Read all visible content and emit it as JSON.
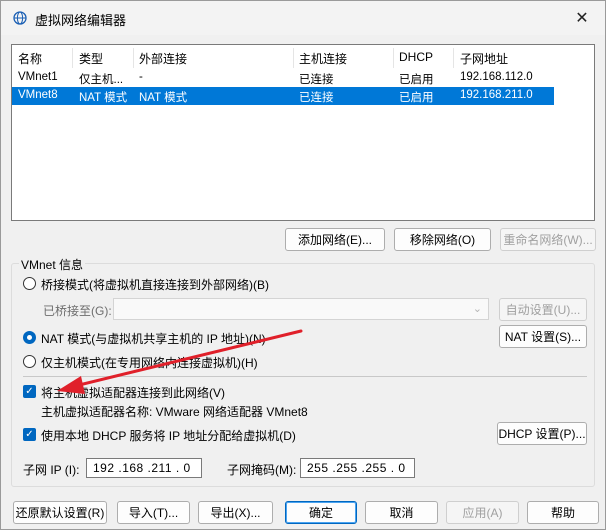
{
  "window": {
    "title": "虚拟网络编辑器",
    "close_label": "✕",
    "icon": "network-globe-icon"
  },
  "table": {
    "headers": [
      "名称",
      "类型",
      "外部连接",
      "主机连接",
      "DHCP",
      "子网地址"
    ],
    "rows": [
      {
        "name": "VMnet1",
        "type": "仅主机...",
        "external": "-",
        "host": "已连接",
        "dhcp": "已启用",
        "subnet": "192.168.112.0",
        "selected": false
      },
      {
        "name": "VMnet8",
        "type": "NAT 模式",
        "external": "NAT 模式",
        "host": "已连接",
        "dhcp": "已启用",
        "subnet": "192.168.211.0",
        "selected": true
      }
    ]
  },
  "network_buttons": {
    "add": "添加网络(E)...",
    "remove": "移除网络(O)",
    "rename": "重命名网络(W)..."
  },
  "vmnet_info": {
    "group_title": "VMnet 信息",
    "bridged_label": "桥接模式(将虚拟机直接连接到外部网络)(B)",
    "bridged_to_label": "已桥接至(G):",
    "bridged_to_value": "",
    "auto_settings": "自动设置(U)...",
    "nat_label": "NAT 模式(与虚拟机共享主机的 IP 地址)(N)",
    "nat_settings": "NAT 设置(S)...",
    "hostonly_label": "仅主机模式(在专用网络内连接虚拟机)(H)",
    "selected_mode": "nat",
    "connect_adapter_label": "将主机虚拟适配器连接到此网络(V)",
    "connect_adapter_checked": true,
    "adapter_name": "主机虚拟适配器名称: VMware 网络适配器 VMnet8",
    "use_dhcp_label": "使用本地 DHCP 服务将 IP 地址分配给虚拟机(D)",
    "use_dhcp_checked": true,
    "dhcp_settings": "DHCP 设置(P)...",
    "subnet_ip_label": "子网 IP (I):",
    "subnet_ip_value": "192 .168 .211 . 0",
    "subnet_mask_label": "子网掩码(M):",
    "subnet_mask_value": "255 .255 .255 . 0"
  },
  "footer_buttons": {
    "restore": "还原默认设置(R)",
    "import": "导入(T)...",
    "export": "导出(X)...",
    "ok": "确定",
    "cancel": "取消",
    "apply": "应用(A)",
    "help": "帮助"
  },
  "colors": {
    "selection": "#0078d7",
    "accent": "#0067c0",
    "annotation_arrow": "#e0202a"
  }
}
